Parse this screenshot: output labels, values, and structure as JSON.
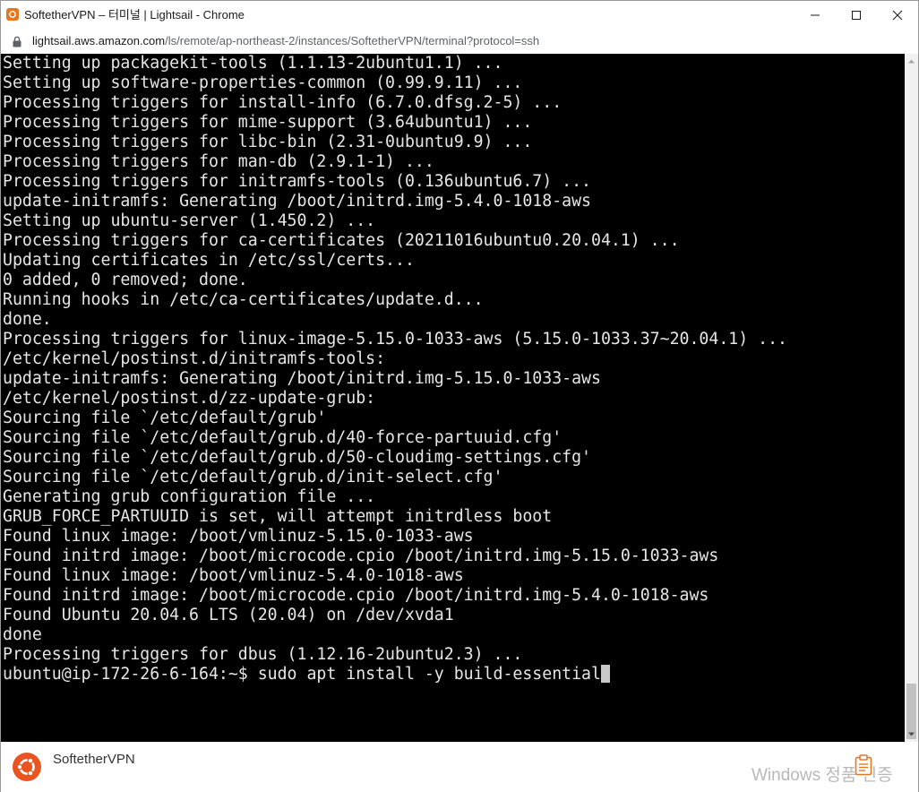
{
  "window": {
    "title": "SoftetherVPN – 터미널 | Lightsail - Chrome"
  },
  "address": {
    "host": "lightsail.aws.amazon.com",
    "path": "/ls/remote/ap-northeast-2/instances/SoftetherVPN/terminal?protocol=ssh"
  },
  "terminal": {
    "lines": [
      "Setting up packagekit-tools (1.1.13-2ubuntu1.1) ...",
      "Setting up software-properties-common (0.99.9.11) ...",
      "Processing triggers for install-info (6.7.0.dfsg.2-5) ...",
      "Processing triggers for mime-support (3.64ubuntu1) ...",
      "Processing triggers for libc-bin (2.31-0ubuntu9.9) ...",
      "Processing triggers for man-db (2.9.1-1) ...",
      "Processing triggers for initramfs-tools (0.136ubuntu6.7) ...",
      "update-initramfs: Generating /boot/initrd.img-5.4.0-1018-aws",
      "Setting up ubuntu-server (1.450.2) ...",
      "Processing triggers for ca-certificates (20211016ubuntu0.20.04.1) ...",
      "Updating certificates in /etc/ssl/certs...",
      "0 added, 0 removed; done.",
      "Running hooks in /etc/ca-certificates/update.d...",
      "done.",
      "Processing triggers for linux-image-5.15.0-1033-aws (5.15.0-1033.37~20.04.1) ...",
      "/etc/kernel/postinst.d/initramfs-tools:",
      "update-initramfs: Generating /boot/initrd.img-5.15.0-1033-aws",
      "/etc/kernel/postinst.d/zz-update-grub:",
      "Sourcing file `/etc/default/grub'",
      "Sourcing file `/etc/default/grub.d/40-force-partuuid.cfg'",
      "Sourcing file `/etc/default/grub.d/50-cloudimg-settings.cfg'",
      "Sourcing file `/etc/default/grub.d/init-select.cfg'",
      "Generating grub configuration file ...",
      "GRUB_FORCE_PARTUUID is set, will attempt initrdless boot",
      "Found linux image: /boot/vmlinuz-5.15.0-1033-aws",
      "Found initrd image: /boot/microcode.cpio /boot/initrd.img-5.15.0-1033-aws",
      "Found linux image: /boot/vmlinuz-5.4.0-1018-aws",
      "Found initrd image: /boot/microcode.cpio /boot/initrd.img-5.4.0-1018-aws",
      "Found Ubuntu 20.04.6 LTS (20.04) on /dev/xvda1",
      "done",
      "Processing triggers for dbus (1.12.16-2ubuntu2.3) ..."
    ],
    "prompt": "ubuntu@ip-172-26-6-164:~$ sudo apt install -y build-essential"
  },
  "bottom": {
    "instance_name": "SoftetherVPN",
    "watermark": "Windows 정품 인증"
  },
  "colors": {
    "terminal_bg": "#000000",
    "terminal_fg": "#e6e6e6",
    "ubuntu_orange": "#e95420",
    "app_icon": "#e8761e"
  },
  "icons": {
    "app": "lightsail-app-icon",
    "lock": "lock-icon",
    "minimize": "minimize-icon",
    "maximize": "maximize-icon",
    "close": "close-icon",
    "ubuntu": "ubuntu-logo-icon",
    "clipboard": "clipboard-icon"
  }
}
